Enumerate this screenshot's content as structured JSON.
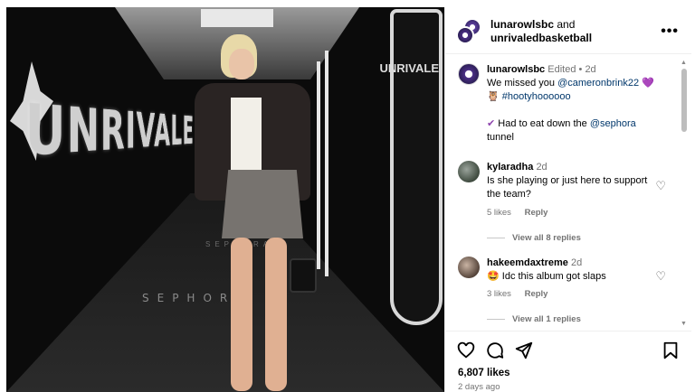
{
  "photo": {
    "wall_text": "UNRIVALE",
    "shield_text": "UNRIVALE",
    "floor_text": "SEPHORA",
    "floor_text_small": "SEPHORA"
  },
  "header": {
    "account1": "lunarowlsbc",
    "conjunction": "and",
    "account2": "unrivaledbasketball",
    "more": "•••"
  },
  "caption": {
    "username": "lunarowlsbc",
    "edited": "Edited",
    "dot": "•",
    "time": "2d",
    "text_before": "We missed you",
    "mention1": "@cameronbrink22",
    "heart_emoji": "💜",
    "owl_emoji": "🦉",
    "hashtag": "#hootyhoooooo",
    "check_emoji": "✔",
    "text_middle": "Had to eat down the",
    "mention2": "@sephora",
    "text_end": "tunnel"
  },
  "comments": [
    {
      "username": "kylaradha",
      "time": "2d",
      "text": "Is she playing or just here to support the team?",
      "likes": "5 likes",
      "reply": "Reply",
      "view_replies": "View all 8 replies"
    },
    {
      "username": "hakeemdaxtreme",
      "time": "2d",
      "emoji": "🤩",
      "text": "Idc this album got slaps",
      "likes": "3 likes",
      "reply": "Reply",
      "view_replies": "View all 1 replies"
    }
  ],
  "footer": {
    "likes": "6,807 likes",
    "timestamp": "2 days ago"
  },
  "icons": {
    "heart": "heart-icon",
    "comment": "comment-icon",
    "share": "share-icon",
    "save": "bookmark-icon"
  },
  "colors": {
    "link": "#00376b",
    "muted": "#737373",
    "brand_purple": "#4b2f85"
  }
}
